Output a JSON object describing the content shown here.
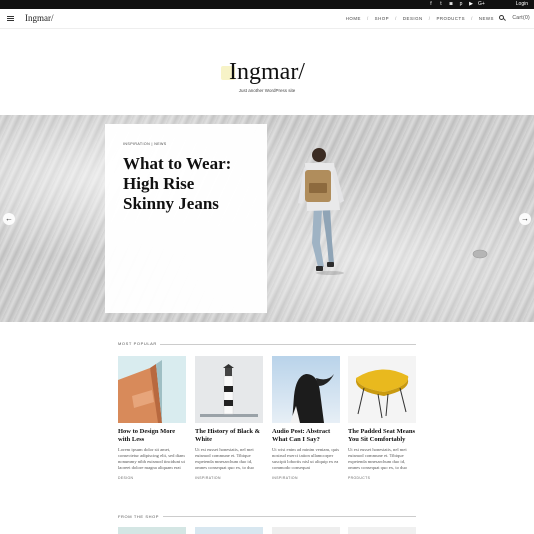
{
  "topbar": {
    "social_icons": [
      "facebook-icon",
      "twitter-icon",
      "instagram-icon",
      "pinterest-icon",
      "youtube-icon",
      "google-plus-icon"
    ],
    "social_glyphs": [
      "f",
      "t",
      "◙",
      "p",
      "▶",
      "G+"
    ],
    "login_label": "Login"
  },
  "nav": {
    "logo": "Ingmar/",
    "items": [
      "HOME",
      "SHOP",
      "DESIGN",
      "PRODUCTS",
      "NEWS"
    ],
    "cart_label": "Cart(0)"
  },
  "site": {
    "title": "Ingmar/",
    "tagline": "Just another WordPress site",
    "accent": "#f7f3c7"
  },
  "hero": {
    "categories": "INSPIRATION | NEWS",
    "title": "What to Wear: High Rise Skinny Jeans",
    "prev_arrow": "←",
    "next_arrow": "→"
  },
  "popular": {
    "label": "MOST POPULAR",
    "posts": [
      {
        "title": "How to Design More with Less",
        "excerpt": "Lorem ipsum dolor sit amet, consectetur adipiscing elit, sed diam nonummy nibh euismod tincidunt ut laoreet dolore magna aliquam erat",
        "category": "DESIGN"
      },
      {
        "title": "The History of Black & White",
        "excerpt": "Ut est eusset honestatis, nel mei euismod commune et. Tibique expetenda mnesarchum duo id, omnes consequat quo ex, to duo",
        "category": "INSPIRATION"
      },
      {
        "title": "Audio Post: Abstract What Can I Say?",
        "excerpt": "Ut wisi enim ad minim veniam, quis nostrud exerci tation ullamcorper suscipit lobortis nisl ut aliquip ex ea commodo consequat",
        "category": "INSPIRATION"
      },
      {
        "title": "The Padded Seat Means You Sit Comfortably",
        "excerpt": "Ut est eusset honestatis, nel mei euismod commune et. Tibique expetenda mnesarchum duo id, omnes consequat quo ex, to duo",
        "category": "PRODUCTS"
      }
    ]
  },
  "shop": {
    "label": "FROM THE SHOP"
  }
}
